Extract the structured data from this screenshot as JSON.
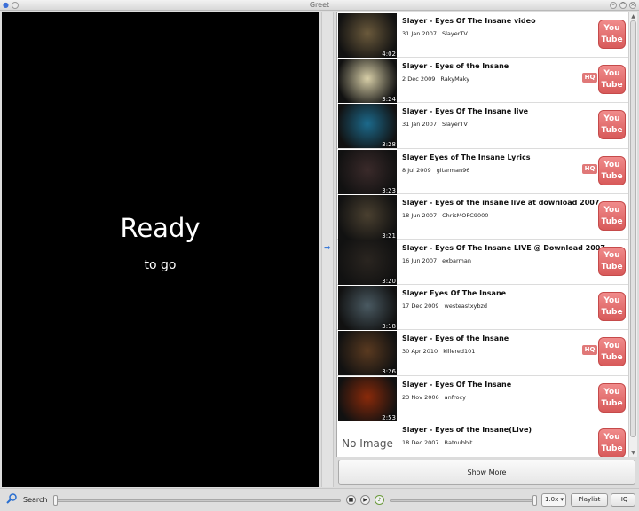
{
  "window": {
    "title": "Greet"
  },
  "player": {
    "status_main": "Ready",
    "status_sub": "to go"
  },
  "results": [
    {
      "title": "Slayer - Eyes Of The Insane video",
      "date": "31 Jan 2007",
      "author": "SlayerTV",
      "duration": "4:02",
      "hq": "",
      "thumb_color": "#6b5a3c"
    },
    {
      "title": "Slayer - Eyes of the Insane",
      "date": "2 Dec 2009",
      "author": "RakyMaky",
      "duration": "3:24",
      "hq": "HQ",
      "thumb_color": "#d8cfa8"
    },
    {
      "title": "Slayer - Eyes Of The Insane live",
      "date": "31 Jan 2007",
      "author": "SlayerTV",
      "duration": "3:28",
      "hq": "",
      "thumb_color": "#1c6a8c"
    },
    {
      "title": "Slayer Eyes of The Insane Lyrics",
      "date": "8 Jul 2009",
      "author": "gitarman96",
      "duration": "3:23",
      "hq": "HQ",
      "thumb_color": "#3a2a2a"
    },
    {
      "title": "Slayer - Eyes of the insane live at download 2007",
      "date": "18 Jun 2007",
      "author": "ChrisMOPC9000",
      "duration": "3:21",
      "hq": "",
      "thumb_color": "#4a4030"
    },
    {
      "title": "Slayer - Eyes Of The Insane LIVE @ Download 2007",
      "date": "16 Jun 2007",
      "author": "exbarman",
      "duration": "3:20",
      "hq": "",
      "thumb_color": "#2a2520"
    },
    {
      "title": "Slayer Eyes Of The Insane",
      "date": "17 Dec 2009",
      "author": "westeastxybzd",
      "duration": "3:18",
      "hq": "",
      "thumb_color": "#4a5a62"
    },
    {
      "title": "Slayer - Eyes of the Insane",
      "date": "30 Apr 2010",
      "author": "killered101",
      "duration": "3:26",
      "hq": "HQ",
      "thumb_color": "#5a3a20"
    },
    {
      "title": "Slayer - Eyes Of The Insane",
      "date": "23 Nov 2006",
      "author": "anfrocy",
      "duration": "2:53",
      "hq": "",
      "thumb_color": "#8a2a0a"
    },
    {
      "title": "Slayer - Eyes of the Insane(Live)",
      "date": "18 Dec 2007",
      "author": "Batnubbit",
      "duration": "",
      "hq": "",
      "thumb_color": "#ffffff",
      "no_image": "No Image"
    }
  ],
  "badge": {
    "line1": "You",
    "line2": "Tube"
  },
  "show_more": "Show More",
  "controls": {
    "search_label": "Search",
    "speed": "1.0x",
    "playlist": "Playlist",
    "hq": "HQ"
  }
}
